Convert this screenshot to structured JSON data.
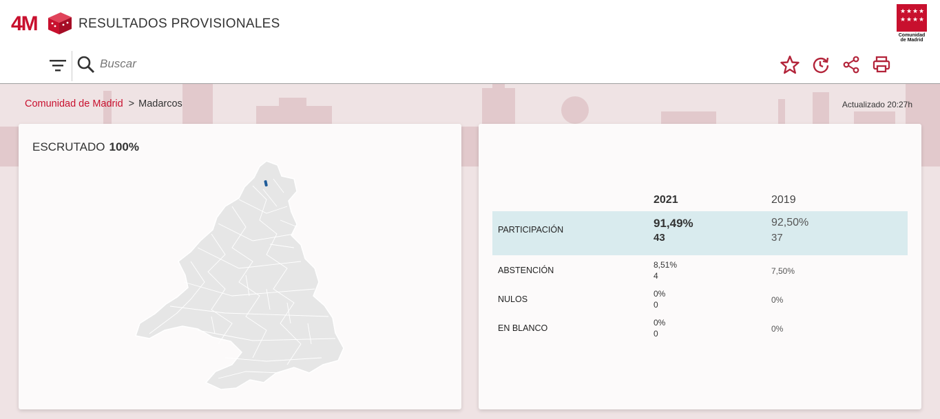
{
  "header": {
    "logo_text": "4M",
    "title": "RESULTADOS PROVISIONALES",
    "region_logo_text": "Comunidad de Madrid",
    "brand_color": "#c8102e"
  },
  "toolbar": {
    "search_placeholder": "Buscar",
    "icons": [
      "filter-icon",
      "search-icon",
      "star-icon",
      "history-icon",
      "share-icon",
      "print-icon"
    ]
  },
  "breadcrumb": {
    "parent": "Comunidad de Madrid",
    "separator": ">",
    "current": "Madarcos"
  },
  "updated": "Actualizado 20:27h",
  "scrutiny": {
    "label": "ESCRUTADO",
    "value": "100%"
  },
  "results": {
    "years": [
      "2021",
      "2019"
    ],
    "rows": [
      {
        "label": "PARTICIPACIÓN",
        "y2021_pct": "91,49%",
        "y2021_count": "43",
        "y2019_pct": "92,50%",
        "y2019_count": "37"
      },
      {
        "label": "ABSTENCIÓN",
        "y2021_pct": "8,51%",
        "y2021_count": "4",
        "y2019_pct": "7,50%"
      },
      {
        "label": "NULOS",
        "y2021_pct": "0%",
        "y2021_count": "0",
        "y2019_pct": "0%"
      },
      {
        "label": "EN BLANCO",
        "y2021_pct": "0%",
        "y2021_count": "0",
        "y2019_pct": "0%"
      }
    ]
  }
}
